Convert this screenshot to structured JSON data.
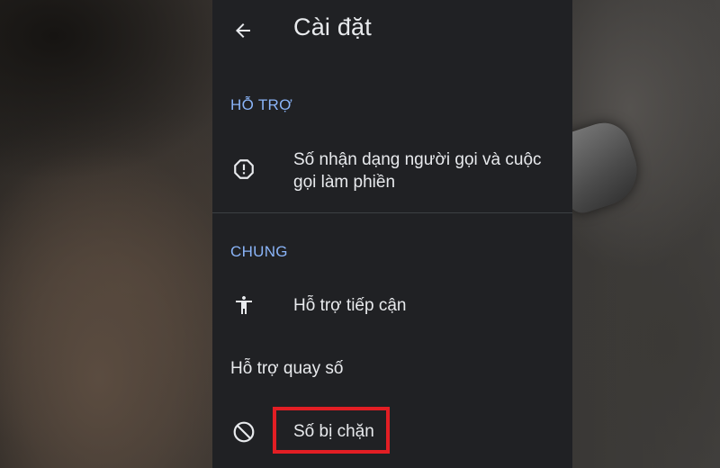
{
  "header": {
    "title": "Cài đặt",
    "back_icon": "arrow-back-icon"
  },
  "sections": {
    "support": {
      "title": "HỖ TRỢ",
      "items": [
        {
          "label": "Số nhận dạng người gọi và cuộc gọi làm phiền",
          "icon": "alert-circle-icon"
        }
      ]
    },
    "general": {
      "title": "CHUNG",
      "items": [
        {
          "label": "Hỗ trợ tiếp cận",
          "icon": "accessibility-icon"
        },
        {
          "label": "Hỗ trợ quay số",
          "icon": ""
        },
        {
          "label": "Số bị chặn",
          "icon": "block-icon"
        }
      ]
    }
  },
  "colors": {
    "panel_background": "#202124",
    "text": "#e8eaed",
    "section_header": "#8ab4f8",
    "divider": "#3c4043",
    "highlight": "#e31e24"
  }
}
